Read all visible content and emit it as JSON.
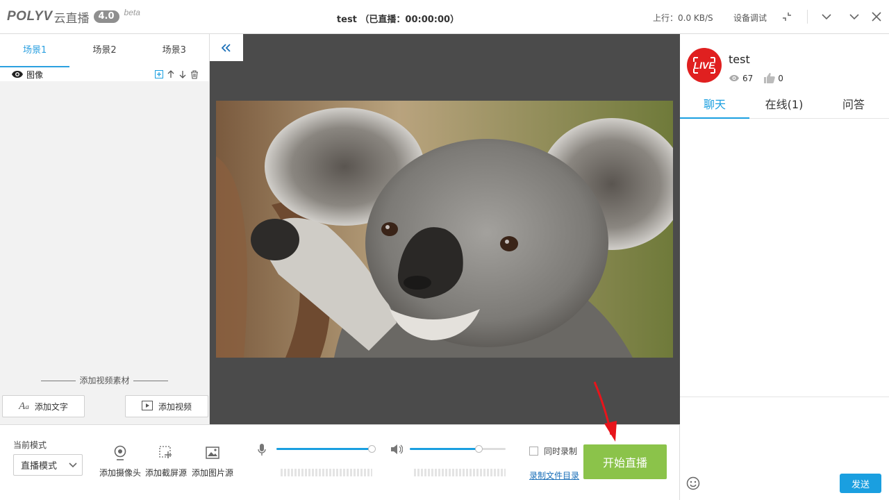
{
  "app": {
    "brand": "POLYV",
    "brand_cn": "云直播",
    "version": "4.0",
    "beta": "beta"
  },
  "titlebar": {
    "title": "test （已直播：00:00:00）",
    "upload_speed": "上行：0.0 KB/S",
    "device_test": "设备调试"
  },
  "scenes": {
    "tabs": [
      {
        "label": "场景1",
        "active": true
      },
      {
        "label": "场景2",
        "active": false
      },
      {
        "label": "场景3",
        "active": false
      }
    ],
    "sources": [
      {
        "label": "图像",
        "visible": true
      }
    ]
  },
  "materials": {
    "title": "添加视频素材",
    "add_text": "添加文字",
    "add_video": "添加视频"
  },
  "bottom": {
    "mode_label": "当前模式",
    "mode_value": "直播模式",
    "add_camera": "添加摄像头",
    "add_screen": "添加截屏源",
    "add_image": "添加图片源",
    "mic_level": 0.98,
    "speaker_level": 0.72,
    "sync_record": "同时录制",
    "record_dir": "录制文件目录",
    "start_live": "开始直播"
  },
  "channel": {
    "live_badge": "LIVE",
    "title": "test",
    "views": "67",
    "likes": "0",
    "tabs": [
      {
        "label": "聊天",
        "active": true
      },
      {
        "label": "在线(1)",
        "active": false
      },
      {
        "label": "问答",
        "active": false
      }
    ],
    "send": "发送"
  },
  "colors": {
    "accent": "#1a9fe0",
    "start_button": "#8bc34a",
    "live_red": "#e02020"
  }
}
